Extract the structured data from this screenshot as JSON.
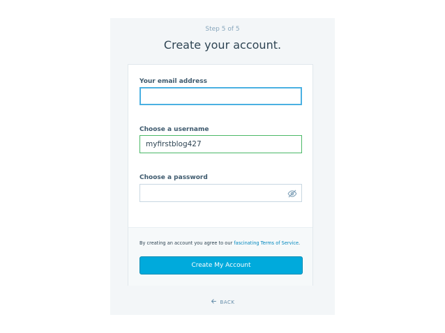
{
  "header": {
    "step": "Step 5 of 5",
    "title": "Create your account."
  },
  "form": {
    "email": {
      "label": "Your email address",
      "value": ""
    },
    "username": {
      "label": "Choose a username",
      "value": "myfirstblog427"
    },
    "password": {
      "label": "Choose a password",
      "value": "",
      "visibility_icon": "eye-slash-icon"
    }
  },
  "footer": {
    "tos_prefix": "By creating an account you agree to our ",
    "tos_link": "fascinating Terms of Service",
    "tos_suffix": ".",
    "submit_label": "Create My Account"
  },
  "nav": {
    "back_label": "BACK",
    "back_icon": "arrow-left-icon"
  },
  "colors": {
    "accent": "#00aadc",
    "focus_border": "#4ab0e2",
    "valid_border": "#4ab866",
    "link": "#0087be"
  }
}
